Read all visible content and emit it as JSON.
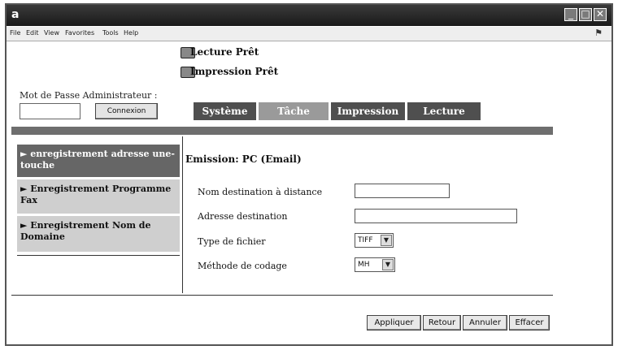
{
  "window": {
    "app_icon": "a",
    "controls": {
      "minimize": "_",
      "maximize": "□",
      "close": "✕"
    }
  },
  "menubar": {
    "items": [
      "File",
      "Edit",
      "View",
      "Favorites",
      "Tools",
      "Help"
    ],
    "throbber_icon": "windows-logo-icon"
  },
  "status": {
    "reading": "Lecture Prêt",
    "printing": "Impression Prêt"
  },
  "admin": {
    "label": "Mot de Passe Administrateur :",
    "password_value": "",
    "button": "Connexion"
  },
  "tabs": [
    {
      "label": "Système",
      "active": false
    },
    {
      "label": "Tâche",
      "active": true
    },
    {
      "label": "Impression",
      "active": false
    },
    {
      "label": "Lecture",
      "active": false
    }
  ],
  "sidebar": {
    "items": [
      {
        "label": "► enregistrement adresse une-touche",
        "active": true
      },
      {
        "label": "► Enregistrement Programme Fax",
        "active": false
      },
      {
        "label": "► Enregistrement Nom de Domaine",
        "active": false
      }
    ]
  },
  "form": {
    "title": "Emission: PC (Email)",
    "fields": {
      "remote_name_label": "Nom destination à distance",
      "remote_name_value": "",
      "address_label": "Adresse destination",
      "address_value": "",
      "file_type_label": "Type de fichier",
      "file_type_value": "TIFF",
      "encoding_label": "Méthode de codage",
      "encoding_value": "MH"
    }
  },
  "actions": {
    "apply": "Appliquer",
    "back": "Retour",
    "cancel": "Annuler",
    "clear": "Effacer"
  },
  "colors": {
    "titlebar": "#2a2a2a",
    "tab_active": "#9a9a9a",
    "tab_inactive": "#4f4f4f",
    "sidebar_active": "#666666",
    "sidebar_inactive": "#cfcfcf"
  }
}
